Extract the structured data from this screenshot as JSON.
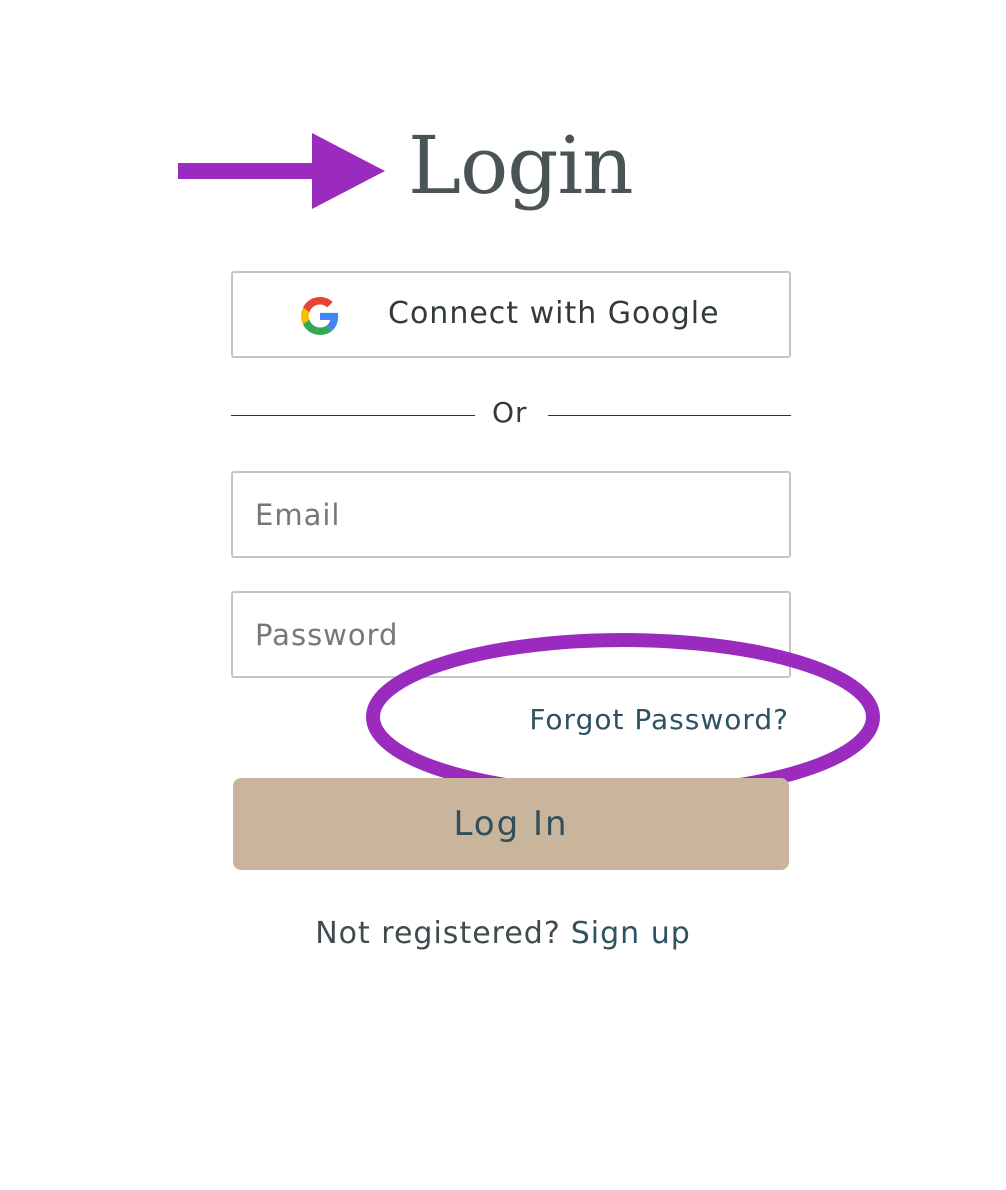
{
  "page": {
    "title": "Login"
  },
  "annotations": {
    "arrow_color": "#9b2bbf",
    "circle_color": "#9b2bbf",
    "arrow_icon": "right-arrow-icon",
    "circle_target": "forgot-password-link"
  },
  "google_button": {
    "label": "Connect with Google",
    "icon": "google-icon"
  },
  "divider": {
    "text": "Or"
  },
  "email_field": {
    "placeholder": "Email",
    "value": ""
  },
  "password_field": {
    "placeholder": "Password",
    "value": ""
  },
  "forgot_password": {
    "label": "Forgot Password?"
  },
  "login_button": {
    "label": "Log In",
    "color": "#c8b59b"
  },
  "signup": {
    "prompt": "Not registered?",
    "link_label": "Sign up"
  },
  "colors": {
    "title_text": "#4a5457",
    "link_text": "#2f5260",
    "field_border": "#c4c4c4"
  }
}
